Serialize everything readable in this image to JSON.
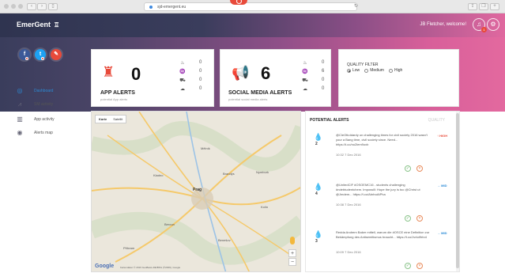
{
  "browser": {
    "url": "sjd-emergent.eu"
  },
  "header": {
    "brand": "EmerGent",
    "welcome": "JB Fletcher, welcome!",
    "notifications_count": "1"
  },
  "social": [
    {
      "name": "facebook-icon",
      "glyph": "f"
    },
    {
      "name": "twitter-icon",
      "glyph": "t"
    },
    {
      "name": "edit-icon",
      "glyph": "✎"
    }
  ],
  "app_alerts": {
    "count": "0",
    "title": "APP ALERTS",
    "subtitle": "potential App alerts",
    "breakdown": [
      "0",
      "0",
      "0",
      "0"
    ]
  },
  "social_alerts": {
    "count": "6",
    "title": "SOCIAL MEDIA ALERTS",
    "subtitle": "potential social media alerts",
    "breakdown": [
      "0",
      "6",
      "0",
      "0"
    ]
  },
  "quality_filter": {
    "title": "QUALITY FILTER",
    "options": [
      "Low",
      "Medium",
      "High"
    ],
    "selected": "Low"
  },
  "sidebar": {
    "items": [
      {
        "label": "Dashboard",
        "active": true
      },
      {
        "label": "SM activity",
        "active": false
      },
      {
        "label": "App activity",
        "active": false
      },
      {
        "label": "Alerts map",
        "active": false
      }
    ]
  },
  "map": {
    "tabs": [
      "Karte",
      "Satellit"
    ],
    "main_city": "Prag",
    "cities": [
      "Kladno",
      "Beroun",
      "Benešov",
      "Mělník",
      "Kolín",
      "Příbram",
      "Nymburk",
      "Brandýs"
    ],
    "attribution": "Kartendaten © 2016 GeoBasis-DE/BKG (©2009), Google"
  },
  "potential_alerts": {
    "title": "POTENTIAL ALERTS",
    "title_right": "QUALITY",
    "items": [
      {
        "number": "2",
        "text": "@CleOttoIdardy un challenging times for civil society 2016 wasn't your a Bang time, civil society since. Need... https://t.co/no2lem9oxb",
        "time": "10:32 7 Dec 2016",
        "level": "HIGH",
        "level_class": "high"
      },
      {
        "number": "4",
        "text": "@UnitedCIF #OSOEMC16 - students challenging #ndebtudentchem. Impossill: Hope the jury is too @Christ ut @Jmdem... https://t.co/AbrbuAtPha",
        "time": "10:38 7 Dec 2016",
        "level": "MID",
        "level_class": "mid"
      },
      {
        "number": "3",
        "text": "Redda Andrem Baker mittell, warum die #OSCE eine Definition zur Bekämpfung des Antisemitismus braucht... https://t.co/Jvrkd9rtn4",
        "time": "10:09 7 Dec 2016",
        "level": "MID",
        "level_class": "mid"
      }
    ]
  }
}
